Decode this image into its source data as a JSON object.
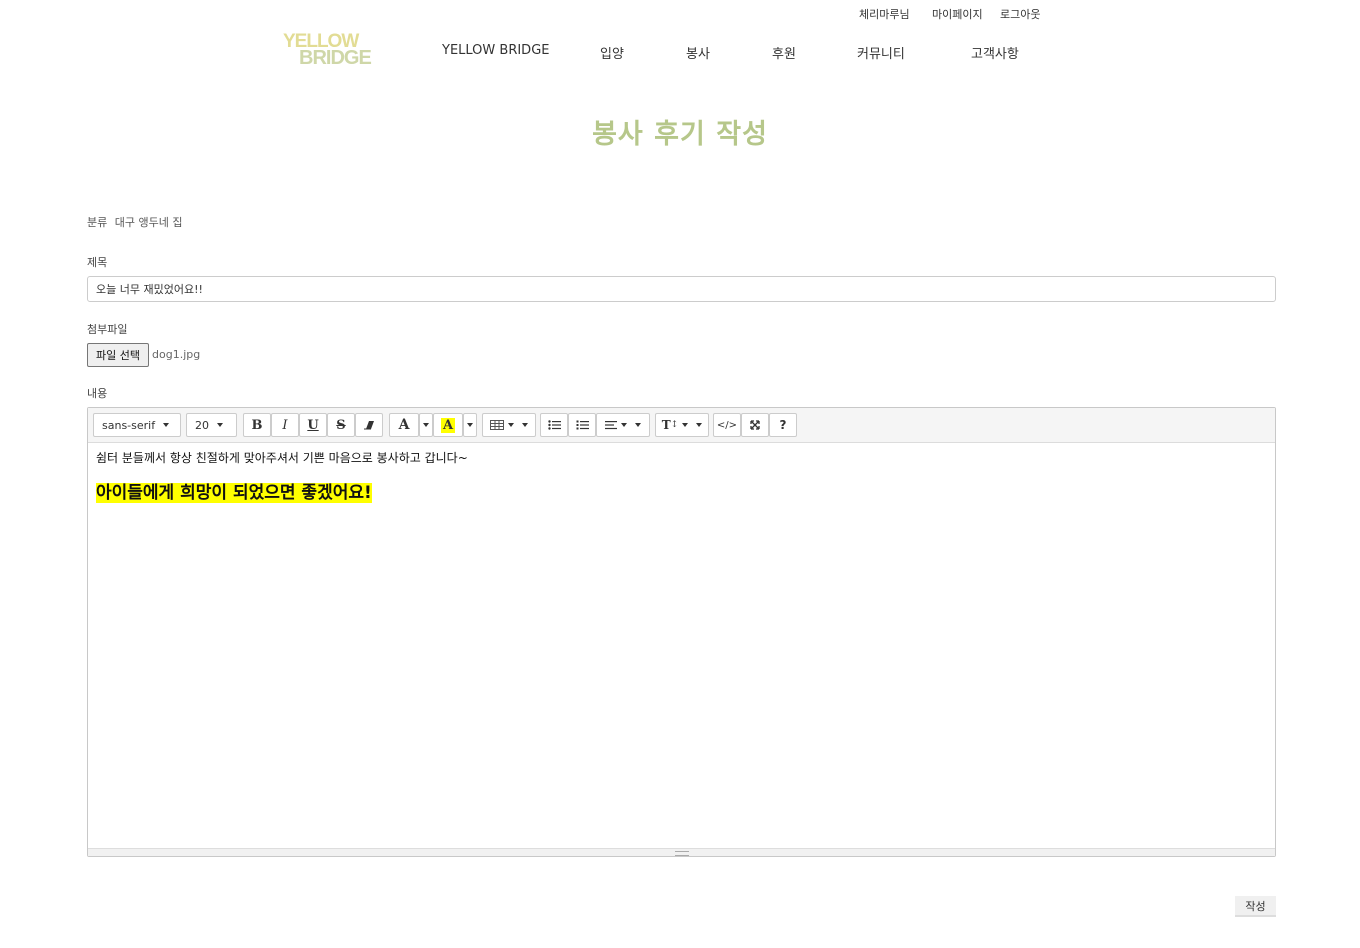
{
  "header": {
    "user_name": "체리마루님",
    "mypage_label": "마이페이지",
    "logout_label": "로그아웃",
    "logo_line1": "YELLOW",
    "logo_line2": "BRIDGE",
    "nav": [
      "YELLOW BRIDGE",
      "입양",
      "봉사",
      "후원",
      "커뮤니티",
      "고객사항"
    ]
  },
  "page_title": "봉사 후기 작성",
  "form": {
    "category_label": "분류",
    "category_value": "대구 앵두네 집",
    "title_label": "제목",
    "title_value": "오늘 너무 재밌었어요!!",
    "file_label": "첨부파일",
    "file_button": "파일 선택",
    "file_name": "dog1.jpg",
    "content_label": "내용"
  },
  "editor": {
    "font_family": "sans-serif",
    "font_size": "20",
    "toolbar_icons": [
      "bold-icon",
      "italic-icon",
      "underline-icon",
      "strikethrough-icon",
      "eraser-icon",
      "font-color-icon",
      "highlight-color-icon",
      "table-icon",
      "unordered-list-icon",
      "ordered-list-icon",
      "align-icon",
      "line-height-icon",
      "code-view-icon",
      "fullscreen-icon",
      "help-icon"
    ],
    "highlight_color": "#ffff00",
    "content_line1": "쉼터 분들께서 항상 친절하게 맞아주셔서 기쁜 마음으로 봉사하고 갑니다~",
    "content_line2": "아이들에게 희망이 되었으면 좋겠어요!"
  },
  "submit_label": "작성",
  "colors": {
    "title_accent": "#b6c78a",
    "logo_yellow": "#e2dc94"
  }
}
